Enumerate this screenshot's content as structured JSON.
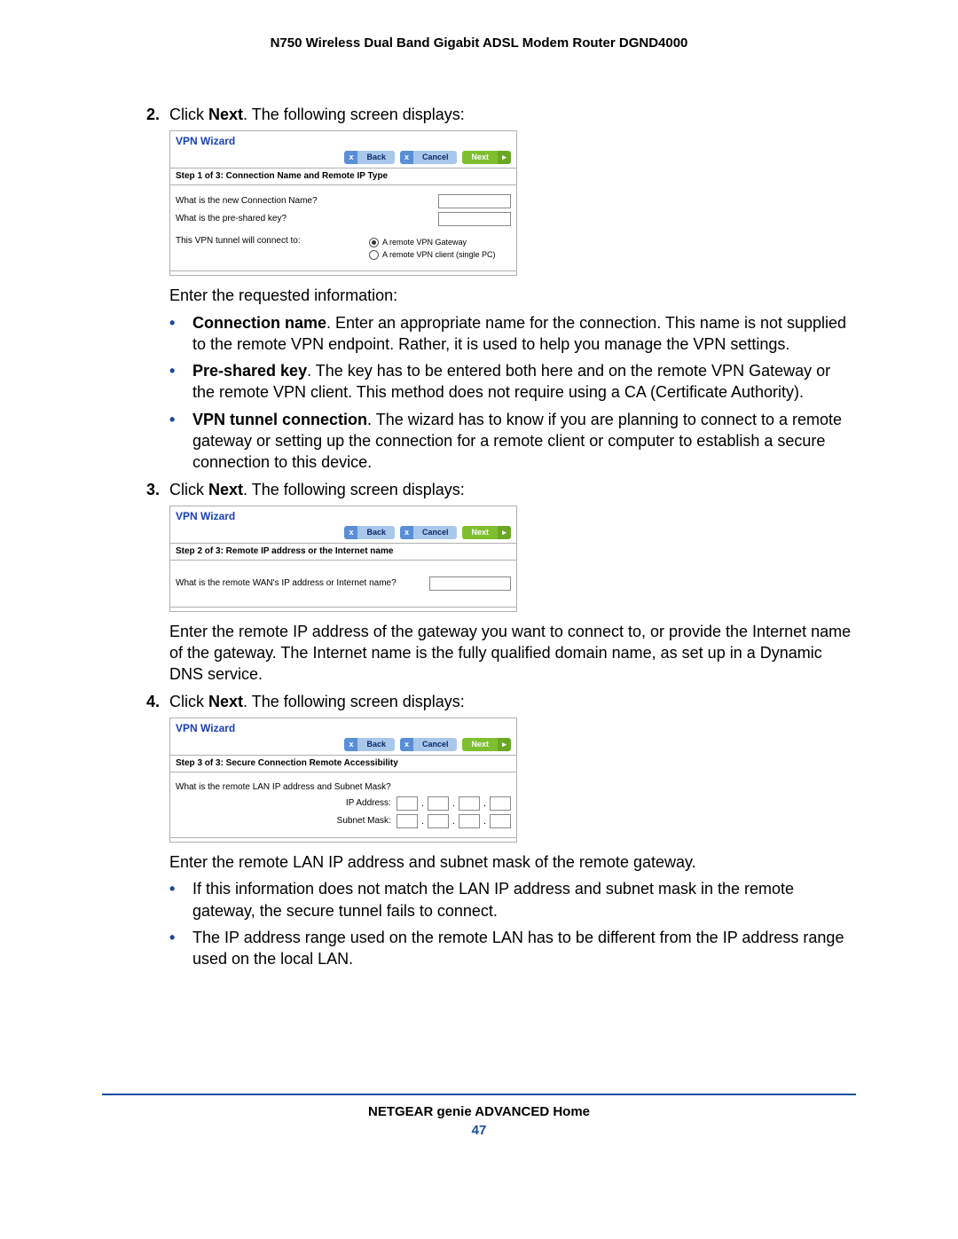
{
  "docTitle": "N750 Wireless Dual Band Gigabit ADSL Modem Router DGND4000",
  "steps": {
    "s2": {
      "num": "2.",
      "lead": "Click ",
      "bold": "Next",
      "tail": ". The following screen displays:"
    },
    "s3": {
      "num": "3.",
      "lead": "Click ",
      "bold": "Next",
      "tail": ". The following screen displays:"
    },
    "s4": {
      "num": "4.",
      "lead": "Click ",
      "bold": "Next",
      "tail": ". The following screen displays:"
    }
  },
  "wizard": {
    "title": "VPN Wizard",
    "back": "Back",
    "cancel": "Cancel",
    "next": "Next",
    "x": "x",
    "arrow": "▸",
    "step1": {
      "header": "Step 1 of 3: Connection Name and Remote IP Type",
      "q1": "What is the new Connection Name?",
      "q2": "What is the pre-shared key?",
      "q3": "This VPN tunnel will connect to:",
      "r1": "A remote VPN Gateway",
      "r2": "A remote VPN client (single PC)"
    },
    "step2": {
      "header": "Step 2 of 3: Remote IP address or the Internet name",
      "q1": "What is the remote WAN's IP address or Internet name?"
    },
    "step3": {
      "header": "Step 3 of 3: Secure Connection Remote Accessibility",
      "q1": "What is the remote LAN IP address and Subnet Mask?",
      "ip": "IP Address:",
      "mask": "Subnet Mask:"
    }
  },
  "text": {
    "enterReq": "Enter the requested information:",
    "b1_bold": "Connection name",
    "b1": ". Enter an appropriate name for the connection. This name is not supplied to the remote VPN endpoint. Rather, it is used to help you manage the VPN settings.",
    "b2_bold": "Pre-shared key",
    "b2": ". The key has to be entered both here and on the remote VPN Gateway or the remote VPN client. This method does not require using a CA (Certificate Authority).",
    "b3_bold": "VPN tunnel connection",
    "b3": ". The wizard has to know if you are planning to connect to a remote gateway or setting up the connection for a remote client or computer to establish a secure connection to this device.",
    "afterStep3": "Enter the remote IP address of the gateway you want to connect to, or provide the Internet name of the gateway. The Internet name is the fully qualified domain name, as set up in a Dynamic DNS service.",
    "afterStep4": "Enter the remote LAN IP address and subnet mask of the remote gateway.",
    "b4": "If this information does not match the LAN IP address and subnet mask in the remote gateway, the secure tunnel fails to connect.",
    "b5": "The IP address range used on the remote LAN has to be different from the IP address range used on the local LAN."
  },
  "footer": "NETGEAR genie ADVANCED Home",
  "pageNum": "47",
  "dot": "•"
}
